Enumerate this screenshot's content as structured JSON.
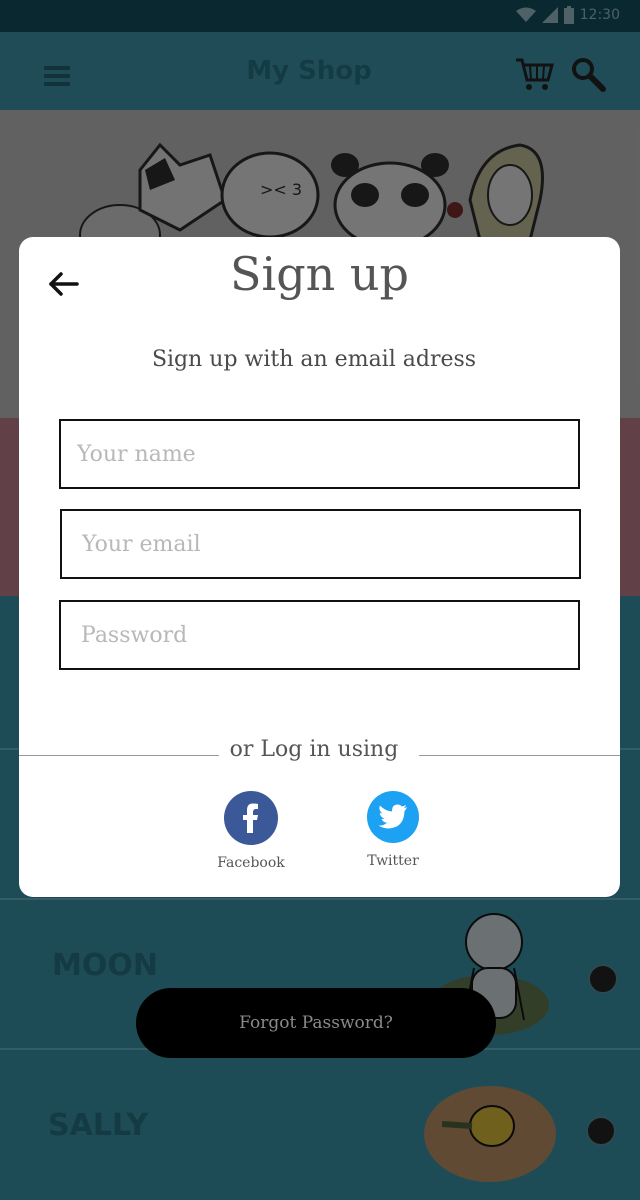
{
  "status_bar": {
    "time": "12:30"
  },
  "app_bar": {
    "title": "My Shop"
  },
  "list": {
    "items": [
      {
        "label": "MOON"
      },
      {
        "label": "SALLY"
      }
    ]
  },
  "modal": {
    "title": "Sign up",
    "subtitle": "Sign up with an email adress",
    "fields": {
      "name_placeholder": "Your name",
      "email_placeholder": "Your email",
      "password_placeholder": "Password"
    },
    "divider_text": "or Log in using",
    "social": {
      "facebook_label": "Facebook",
      "twitter_label": "Twitter"
    }
  },
  "forgot_password_label": "Forgot Password?",
  "icons": {
    "back": "arrow-left-icon",
    "menu": "menu-icon",
    "cart": "cart-icon",
    "search": "search-icon",
    "facebook": "facebook-icon",
    "twitter": "twitter-icon",
    "chevron": "chevron-down-icon"
  },
  "colors": {
    "facebook": "#3b5998",
    "twitter": "#1da1f2",
    "overlay": "rgba(0,0,0,0.30)"
  }
}
